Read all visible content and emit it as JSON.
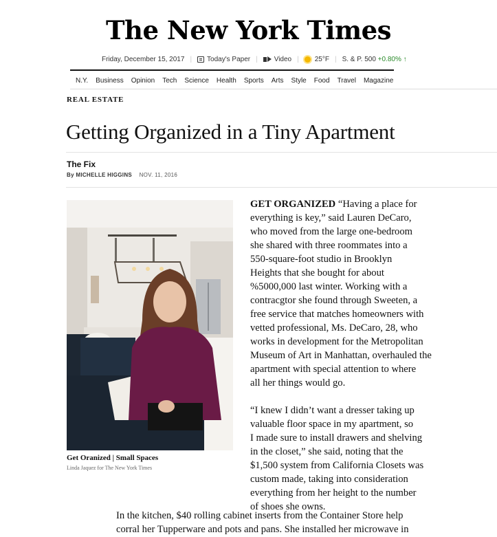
{
  "masthead": "The New York Times",
  "infobar": {
    "date": "Friday, December 15, 2017",
    "todays_paper": "Today's Paper",
    "video": "Video",
    "weather": "25°F",
    "market_label": "S. & P. 500",
    "market_value": "+0.80% ↑"
  },
  "nav": [
    "N.Y.",
    "Business",
    "Opinion",
    "Tech",
    "Science",
    "Health",
    "Sports",
    "Arts",
    "Style",
    "Food",
    "Travel",
    "Magazine"
  ],
  "article": {
    "section": "REAL ESTATE",
    "headline": "Getting Organized in a Tiny Apartment",
    "column": "The Fix",
    "byline": "By MICHELLE HIGGINS",
    "date": "NOV. 11, 2016",
    "caption": "Get Oranized | Small Spaces",
    "credit": "Linda Jaquez for The New York Times",
    "p1_lead": "GET ORGANIZED",
    "p1_lines": [
      "“Having a place for",
      "everything is key,” said Lauren DeCaro,",
      "who moved from the large one-bedroom",
      "she shared with three roommates into a",
      "550-square-foot studio in Brooklyn",
      "Heights that she bought for about",
      "%5000,000 last winter. Working with a",
      "contracgtor she found through Sweeten, a",
      "free service that matches homeowners with",
      "vetted professional, Ms. DeCaro, 28, who",
      "works in development for the Metropolitan",
      "Museum of Art in Manhattan, overhauled the",
      "apartment with special attention to where",
      "all her things would go."
    ],
    "p2_lines": [
      "“I knew I didn’t want a dresser taking up",
      "valuable floor space in my apartment, so",
      "I made sure to install drawers and shelving",
      "in the closet,” she said, noting that the",
      "$1,500 system from California Closets was",
      "custom made, taking into consideration",
      "everything from her height to the number",
      "of shoes she owns."
    ],
    "p3_lines": [
      "In the kitchen, $40 rolling cabinet inserts from the Container Store help",
      "corral her Tupperware and pots and pans. She installed her microwave in"
    ]
  }
}
